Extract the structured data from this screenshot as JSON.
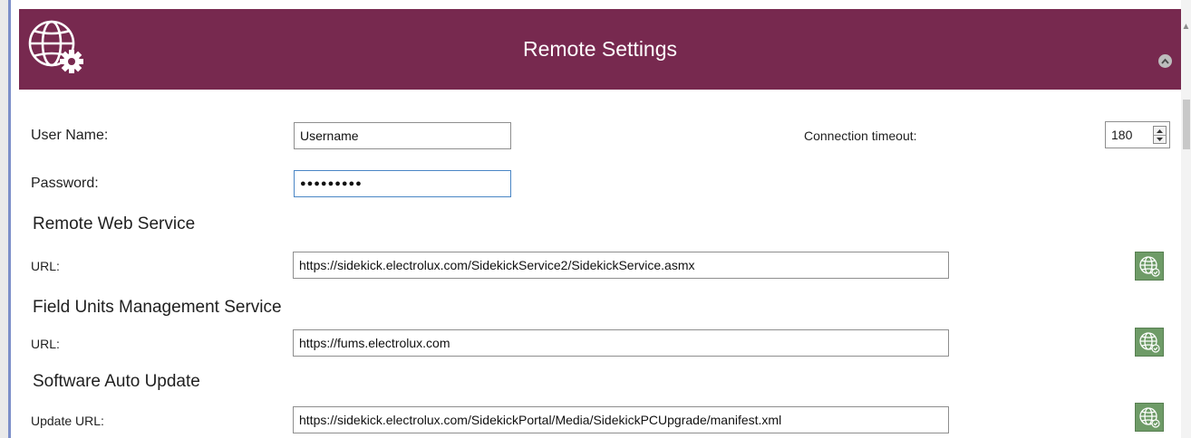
{
  "header": {
    "title": "Remote Settings"
  },
  "credentials": {
    "username_label": "User Name:",
    "username_value": "Username",
    "password_label": "Password:",
    "password_value": "●●●●●●●●●",
    "timeout_label": "Connection timeout:",
    "timeout_value": "180"
  },
  "remote_web_service": {
    "title": "Remote Web Service",
    "url_label": "URL:",
    "url_value": "https://sidekick.electrolux.com/SidekickService2/SidekickService.asmx"
  },
  "field_units": {
    "title": "Field Units Management Service",
    "url_label": "URL:",
    "url_value": "https://fums.electrolux.com"
  },
  "auto_update": {
    "title": "Software Auto Update",
    "url_label": "Update URL:",
    "url_value": "https://sidekick.electrolux.com/SidekickPortal/Media/SidekickPCUpgrade/manifest.xml"
  },
  "icons": {
    "header_logo": "globe-gear-icon",
    "collapse": "chevron-up-icon",
    "test_connection": "globe-check-icon"
  },
  "colors": {
    "header_bg": "#77294f",
    "button_green": "#6e9b67",
    "focus_border": "#4a86c5"
  }
}
